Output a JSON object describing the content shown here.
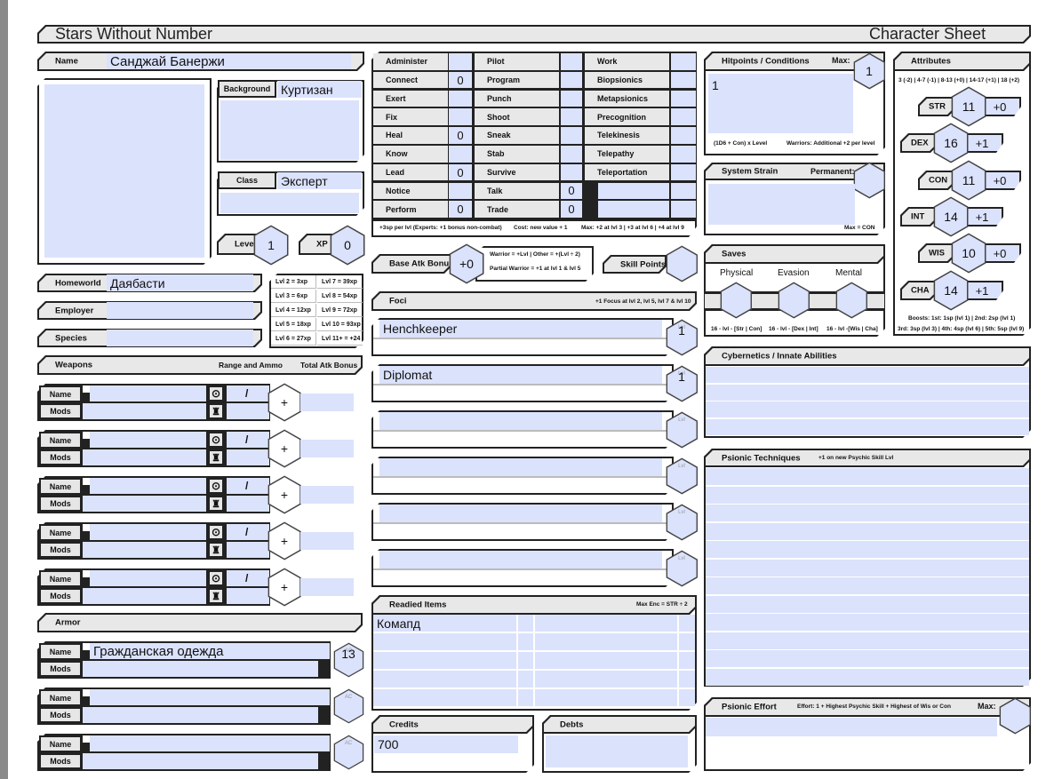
{
  "title": {
    "left": "Stars Without Number",
    "right": "Character Sheet"
  },
  "identity": {
    "name_label": "Name",
    "name": "Санджай Банержи",
    "background_label": "Background",
    "background": "Куртизан",
    "class_label": "Class",
    "class": "Эксперт",
    "level_label": "Level",
    "level": "1",
    "xp_label": "XP",
    "xp": "0",
    "homeworld_label": "Homeworld",
    "homeworld": "Даябасти",
    "employer_label": "Employer",
    "employer": "",
    "species_label": "Species",
    "species": ""
  },
  "xp_table": [
    "Lvl 2 = 3xp",
    "Lvl 7 = 39xp",
    "Lvl 3 = 6xp",
    "Lvl 8 = 54xp",
    "Lvl 4 = 12xp",
    "Lvl 9 = 72xp",
    "Lvl 5 = 18xp",
    "Lvl 10 = 93xp",
    "Lvl 6 = 27xp",
    "Lvl 11+ = +24"
  ],
  "skills": [
    {
      "name": "Administer",
      "value": ""
    },
    {
      "name": "Connect",
      "value": "0"
    },
    {
      "name": "Exert",
      "value": ""
    },
    {
      "name": "Fix",
      "value": ""
    },
    {
      "name": "Heal",
      "value": "0"
    },
    {
      "name": "Know",
      "value": ""
    },
    {
      "name": "Lead",
      "value": "0"
    },
    {
      "name": "Notice",
      "value": ""
    },
    {
      "name": "Perform",
      "value": "0"
    },
    {
      "name": "Pilot",
      "value": ""
    },
    {
      "name": "Program",
      "value": ""
    },
    {
      "name": "Punch",
      "value": ""
    },
    {
      "name": "Shoot",
      "value": ""
    },
    {
      "name": "Sneak",
      "value": ""
    },
    {
      "name": "Stab",
      "value": ""
    },
    {
      "name": "Survive",
      "value": ""
    },
    {
      "name": "Talk",
      "value": "0"
    },
    {
      "name": "Trade",
      "value": "0"
    },
    {
      "name": "Work",
      "value": ""
    },
    {
      "name": "Biopsionics",
      "value": ""
    },
    {
      "name": "Metapsionics",
      "value": ""
    },
    {
      "name": "Precognition",
      "value": ""
    },
    {
      "name": "Telekinesis",
      "value": ""
    },
    {
      "name": "Telepathy",
      "value": ""
    },
    {
      "name": "Teleportation",
      "value": ""
    },
    {
      "name": "",
      "value": ""
    },
    {
      "name": "",
      "value": ""
    }
  ],
  "skills_note": {
    "sp": "+3sp per lvl  (Experts: +1 bonus non-combat)",
    "cost": "Cost:  new value + 1",
    "max": "Max:  +2 at lvl 3  |  +3 at lvl 6  |  +4 at lvl 9"
  },
  "bab": {
    "label": "Base Atk Bonus",
    "value": "+0",
    "note1": "Warrior = +Lvl  |  Other = +(Lvl ÷ 2)",
    "note2": "Partial Warrior = +1 at lvl 1 & lvl 5"
  },
  "skill_points": {
    "label": "Skill Points",
    "value": ""
  },
  "foci": {
    "label": "Foci",
    "note": "+1 Focus at lvl 2, lvl 5, lvl 7 & lvl 10",
    "lvl_label": "Lvl",
    "items": [
      {
        "name": "Henchkeeper",
        "level": "1"
      },
      {
        "name": "Diplomat",
        "level": "1"
      },
      {
        "name": "",
        "level": ""
      },
      {
        "name": "",
        "level": ""
      },
      {
        "name": "",
        "level": ""
      },
      {
        "name": "",
        "level": ""
      }
    ]
  },
  "weapons": {
    "label": "Weapons",
    "range_label": "Range and Ammo",
    "atk_label": "Total Atk Bonus",
    "name_label": "Name",
    "mods_label": "Mods",
    "sep": "/",
    "plus": "+",
    "items": [
      {
        "name": "",
        "mods": "",
        "range": "",
        "ammo": "",
        "atk": ""
      },
      {
        "name": "",
        "mods": "",
        "range": "",
        "ammo": "",
        "atk": ""
      },
      {
        "name": "",
        "mods": "",
        "range": "",
        "ammo": "",
        "atk": ""
      },
      {
        "name": "",
        "mods": "",
        "range": "",
        "ammo": "",
        "atk": ""
      },
      {
        "name": "",
        "mods": "",
        "range": "",
        "ammo": "",
        "atk": ""
      }
    ]
  },
  "armor": {
    "label": "Armor",
    "ac_label": "AC",
    "name_label": "Name",
    "mods_label": "Mods",
    "items": [
      {
        "name": "Гражданская одежда",
        "mods": "",
        "ac": "13"
      },
      {
        "name": "",
        "mods": "",
        "ac": ""
      },
      {
        "name": "",
        "mods": "",
        "ac": ""
      }
    ]
  },
  "readied": {
    "label": "Readied Items",
    "note": "Max Enc = STR ÷ 2",
    "items": [
      "Комапд",
      "",
      "",
      "",
      ""
    ]
  },
  "credits": {
    "label": "Credits",
    "value": "700"
  },
  "debts": {
    "label": "Debts",
    "value": ""
  },
  "hp": {
    "label": "Hitpoints / Conditions",
    "max_label": "Max:",
    "max": "1",
    "notes": "1",
    "formula": "(1D6 + Con) x Level",
    "warriors": "Warriors:  Additional +2 per level"
  },
  "strain": {
    "label": "System Strain",
    "permanent_label": "Permanent:",
    "permanent": "",
    "notes": "",
    "max_note": "Max = CON"
  },
  "saves": {
    "label": "Saves",
    "items": [
      {
        "name": "Physical",
        "value": "",
        "formula": "16 - lvl - [Str | Con]"
      },
      {
        "name": "Evasion",
        "value": "",
        "formula": "16 - lvl - [Dex | Int]"
      },
      {
        "name": "Mental",
        "value": "",
        "formula": "16 - lvl -[Wis | Cha]"
      }
    ]
  },
  "attributes": {
    "label": "Attributes",
    "scale": "3 (-2)  |  4-7 (-1)  |  8-13 (+0)  |  14-17 (+1)  |  18 (+2)",
    "items": [
      {
        "name": "STR",
        "score": "11",
        "mod": "+0"
      },
      {
        "name": "DEX",
        "score": "16",
        "mod": "+1"
      },
      {
        "name": "CON",
        "score": "11",
        "mod": "+0"
      },
      {
        "name": "INT",
        "score": "14",
        "mod": "+1"
      },
      {
        "name": "WIS",
        "score": "10",
        "mod": "+0"
      },
      {
        "name": "CHA",
        "score": "14",
        "mod": "+1"
      }
    ],
    "boosts1": "Boosts:  1st: 1sp (lvl 1)  |  2nd: 2sp (lvl 1)",
    "boosts2": "3rd: 3sp (lvl 3)  |  4th: 4sp (lvl 6)  |  5th: 5sp (lvl 9)"
  },
  "cybernetics": {
    "label": "Cybernetics / Innate Abilities"
  },
  "psionic_techniques": {
    "label": "Psionic Techniques",
    "note": "+1 on new Psychic Skill Lvl"
  },
  "psionic_effort": {
    "label": "Psionic Effort",
    "note": "Effort: 1 + Highest Psychic Skill + Highest of Wis or Con",
    "max_label": "Max:",
    "max": ""
  }
}
